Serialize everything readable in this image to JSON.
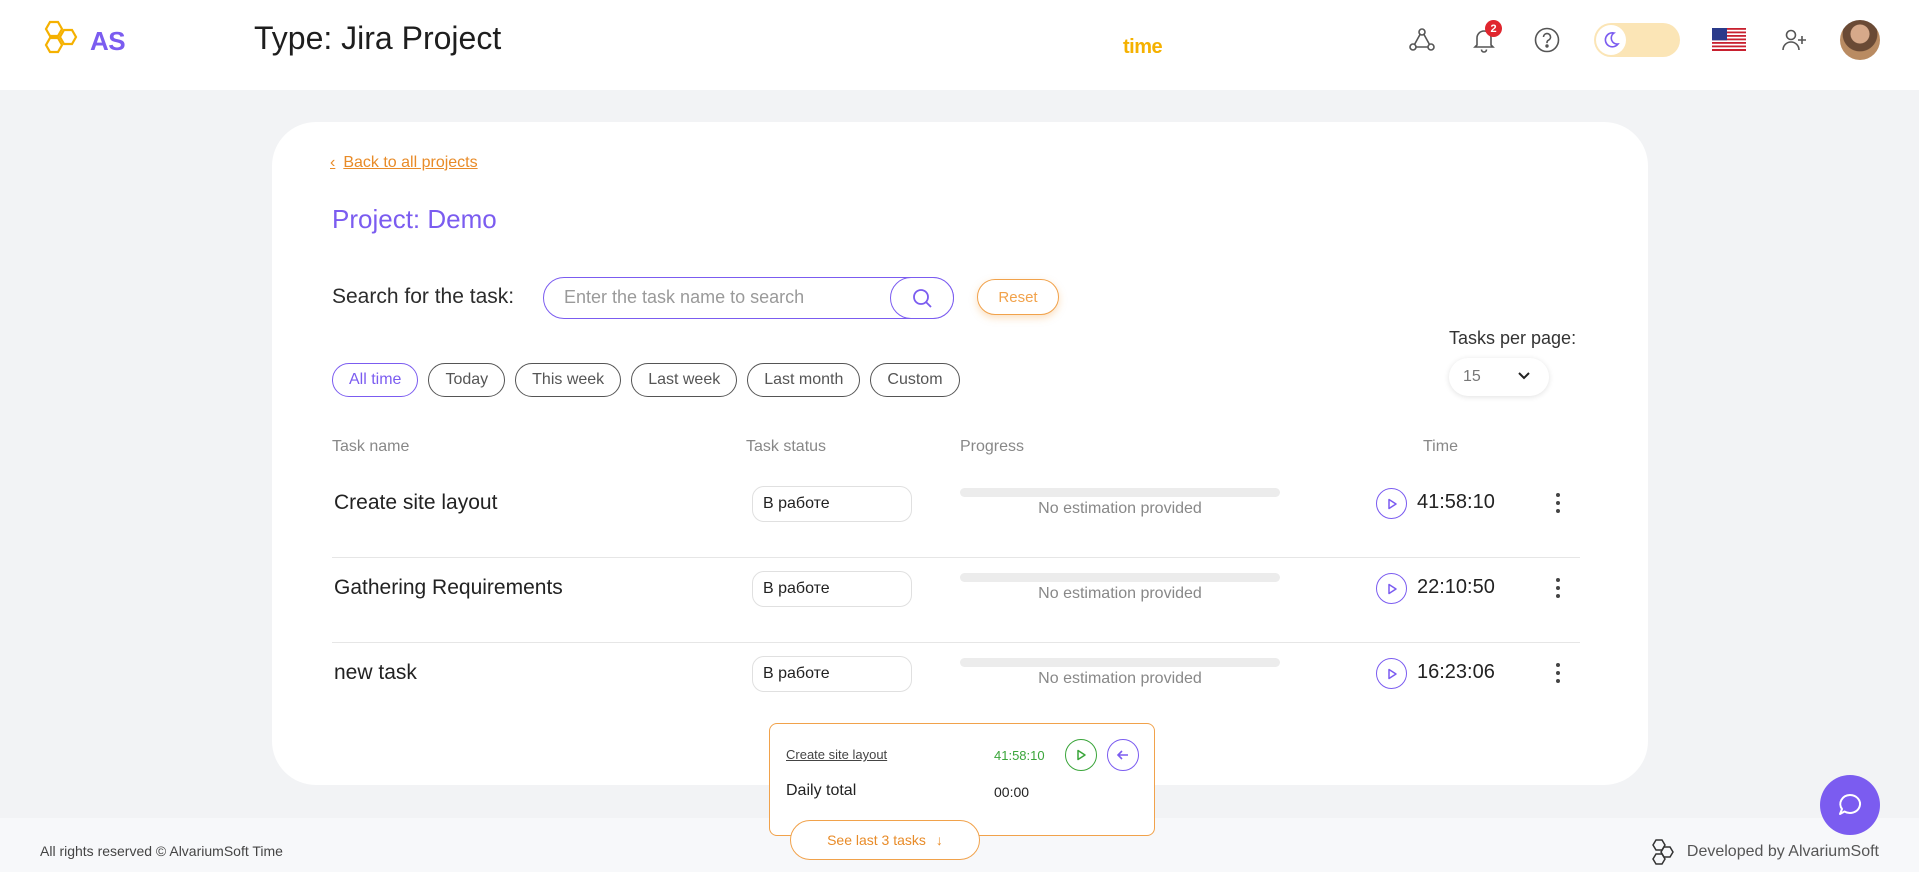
{
  "header": {
    "logo_as": "AS",
    "logo_time": "time",
    "title": "Type: Jira Project",
    "notifications_count": "2"
  },
  "card": {
    "back_link": "Back to all projects",
    "project_title": "Project: Demo",
    "search": {
      "label": "Search for the task:",
      "placeholder": "Enter the task name to search",
      "value": ""
    },
    "reset_label": "Reset",
    "filters": [
      "All time",
      "Today",
      "This week",
      "Last week",
      "Last month",
      "Custom"
    ],
    "active_filter": "All time",
    "tasks_per_page": {
      "label": "Tasks per page:",
      "value": "15"
    },
    "columns": {
      "task_name": "Task name",
      "task_status": "Task status",
      "progress": "Progress",
      "time": "Time"
    },
    "tasks": [
      {
        "name": "Create site layout",
        "status": "В работе",
        "progress": 0,
        "progress_text": "No estimation provided",
        "time": "41:58:10"
      },
      {
        "name": "Gathering Requirements",
        "status": "В работе",
        "progress": 0,
        "progress_text": "No estimation provided",
        "time": "22:10:50"
      },
      {
        "name": "new task",
        "status": "В работе",
        "progress": 0,
        "progress_text": "No estimation provided",
        "time": "16:23:06"
      }
    ]
  },
  "widget": {
    "task_name": "Create site layout",
    "task_time": "41:58:10",
    "daily_total_label": "Daily total",
    "daily_total_value": "00:00"
  },
  "footer": {
    "copyright": "All rights reserved © AlvariumSoft Time",
    "developed_by": "Developed by AlvariumSoft",
    "see_last_label": "See last 3 tasks"
  },
  "colors": {
    "accent": "#7b5cf0",
    "brand_yellow": "#f5b100",
    "orange": "#f1a24b",
    "green": "#3aa53a"
  }
}
